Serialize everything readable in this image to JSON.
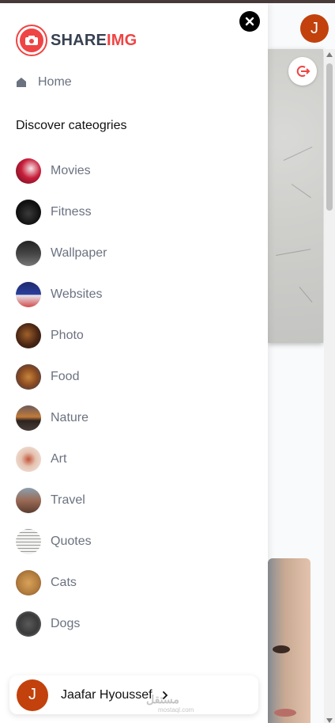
{
  "app": {
    "brand_part1": "SHARE",
    "brand_part2": "IMG",
    "brand_color": "#ef4444",
    "accent_avatar_color": "#c2410c"
  },
  "header": {
    "user_initial": "J"
  },
  "sidebar": {
    "home_label": "Home",
    "section_title": "Discover cateogries",
    "categories": [
      {
        "label": "Movies",
        "icon": "movies-thumbnail"
      },
      {
        "label": "Fitness",
        "icon": "fitness-thumbnail"
      },
      {
        "label": "Wallpaper",
        "icon": "wallpaper-thumbnail"
      },
      {
        "label": "Websites",
        "icon": "websites-thumbnail"
      },
      {
        "label": "Photo",
        "icon": "photo-thumbnail"
      },
      {
        "label": "Food",
        "icon": "food-thumbnail"
      },
      {
        "label": "Nature",
        "icon": "nature-thumbnail"
      },
      {
        "label": "Art",
        "icon": "art-thumbnail"
      },
      {
        "label": "Travel",
        "icon": "travel-thumbnail"
      },
      {
        "label": "Quotes",
        "icon": "quotes-thumbnail"
      },
      {
        "label": "Cats",
        "icon": "cats-thumbnail"
      },
      {
        "label": "Dogs",
        "icon": "dogs-thumbnail"
      }
    ]
  },
  "user": {
    "initial": "J",
    "name": "Jaafar Hyoussef"
  },
  "watermark": {
    "text": "مستقل",
    "subtext": "mostaql.com"
  }
}
